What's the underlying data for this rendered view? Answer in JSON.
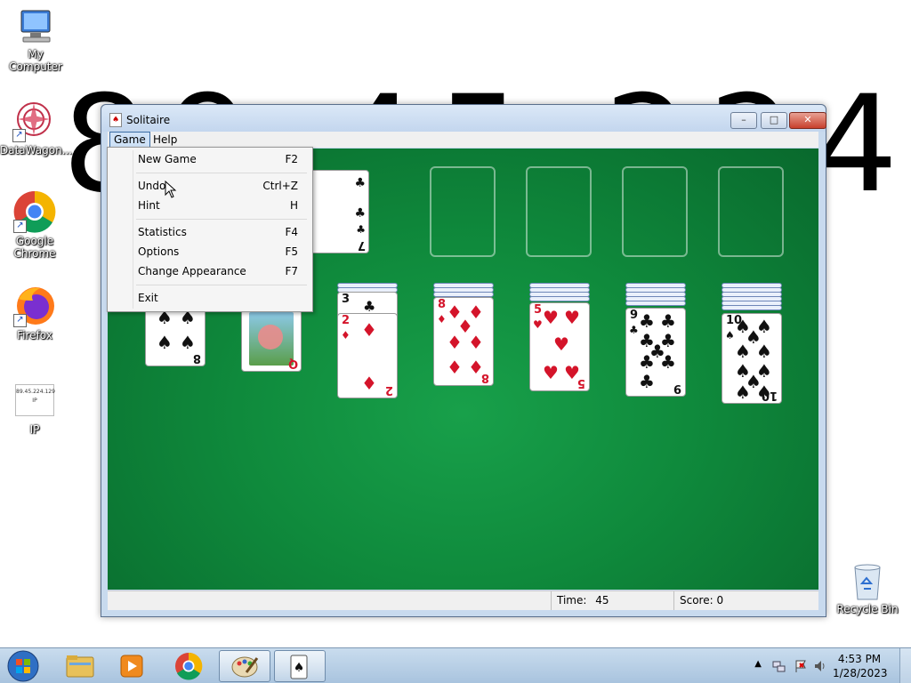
{
  "wallpaper": {
    "ip_digits": "89.45.224.129"
  },
  "desktop": {
    "icons": [
      {
        "label": "My Computer"
      },
      {
        "label": "DataWagon..."
      },
      {
        "label": "Google Chrome"
      },
      {
        "label": "Firefox"
      },
      {
        "label": "IP",
        "file_line1": "89.45.224.129",
        "file_line2": "IP"
      },
      {
        "label": "Recycle Bin"
      }
    ]
  },
  "window": {
    "title": "Solitaire",
    "controls": {
      "minimize": "–",
      "maximize": "□",
      "close": "✕"
    },
    "menubar": [
      {
        "label": "Game"
      },
      {
        "label": "Help"
      }
    ],
    "status": {
      "time_label": "Time:",
      "time_value": "45",
      "score_label": "Score:",
      "score_value": "0",
      "score_text": "Score: 0"
    }
  },
  "game_menu": {
    "items": [
      {
        "label": "New Game",
        "shortcut": "F2"
      },
      {
        "label": "Undo",
        "shortcut": "Ctrl+Z"
      },
      {
        "label": "Hint",
        "shortcut": "H"
      },
      {
        "label": "Statistics",
        "shortcut": "F4"
      },
      {
        "label": "Options",
        "shortcut": "F5"
      },
      {
        "label": "Change Appearance",
        "shortcut": "F7"
      },
      {
        "label": "Exit",
        "shortcut": ""
      }
    ]
  },
  "board": {
    "waste_top": {
      "rank": "7",
      "suit": "♣"
    },
    "tableau": [
      {
        "rank": "8",
        "suit": "♠",
        "hidden": 0
      },
      {
        "rank": "Q",
        "suit": "♥",
        "hidden": 0
      },
      {
        "rank": "2",
        "suit": "♦",
        "hidden": 2,
        "under": {
          "rank": "3",
          "suit": "♣"
        }
      },
      {
        "rank": "8",
        "suit": "♦",
        "hidden": 3
      },
      {
        "rank": "5",
        "suit": "♥",
        "hidden": 4
      },
      {
        "rank": "9",
        "suit": "♣",
        "hidden": 5
      },
      {
        "rank": "10",
        "suit": "♠",
        "hidden": 6
      }
    ]
  },
  "taskbar": {
    "start": "start-orb",
    "pinned": [
      "explorer",
      "media-player",
      "chrome",
      "paint",
      "solitaire"
    ],
    "clock_time": "4:53 PM",
    "clock_date": "1/28/2023"
  },
  "colors": {
    "felt": "#0f8a3c",
    "red_suit": "#d4142a",
    "black_suit": "#111111"
  }
}
